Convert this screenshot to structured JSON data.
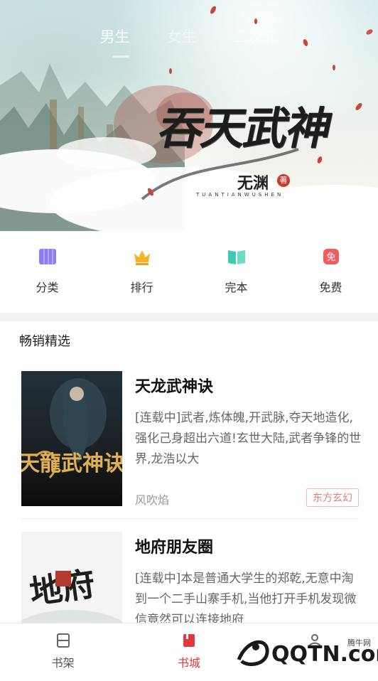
{
  "hero": {
    "tabs": [
      "男生",
      "女生",
      "二次元"
    ],
    "active_tab": 0,
    "title": "吞天武神",
    "author": "无渊",
    "seal": "著",
    "pinyin": "TUANTIANWUSHEN"
  },
  "categories": [
    {
      "label": "分类",
      "icon": "category-icon",
      "color": "#8e7cf0"
    },
    {
      "label": "排行",
      "icon": "crown-icon",
      "color": "#f5b423"
    },
    {
      "label": "完本",
      "icon": "open-book-icon",
      "color": "#40c9b6"
    },
    {
      "label": "免费",
      "icon": "free-badge-icon",
      "color": "#f25b5b",
      "badge": "免"
    }
  ],
  "section": {
    "title": "畅销精选"
  },
  "books": [
    {
      "title": "天龙武神诀",
      "desc": "[连载中]武者,炼体魄,开武脉,夺天地造化,强化己身超出六道!玄世大陆,武者争锋的世界,龙浩以大",
      "author": "风吹焰",
      "tag": "东方玄幻",
      "cover_text": "天龍武神诀"
    },
    {
      "title": "地府朋友圈",
      "desc": "[连载中]本是普通大学生的郑乾,无意中淘到一个二手山寨手机,当他打开手机发现微信竟然可以连接地府",
      "author": "",
      "tag": "",
      "cover_text": "地府"
    }
  ],
  "bottom_nav": [
    {
      "label": "书架",
      "icon": "bookshelf-icon"
    },
    {
      "label": "书城",
      "icon": "bookstore-icon"
    },
    {
      "label": "",
      "icon": "profile-icon"
    }
  ],
  "active_nav": 1,
  "watermark": {
    "text": "QQTN.com",
    "site": "腾牛网"
  },
  "colors": {
    "accent": "#e23a3a",
    "tag_text": "#e27c7c"
  }
}
